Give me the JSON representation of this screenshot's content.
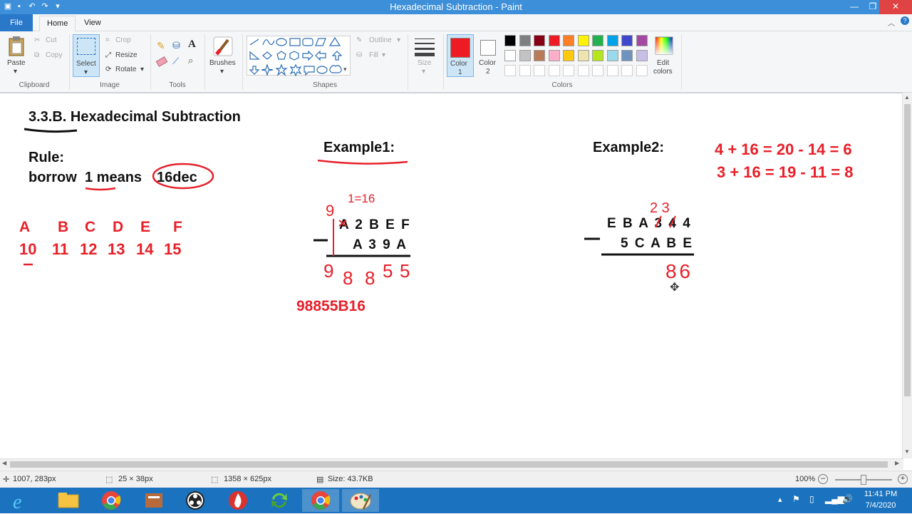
{
  "window": {
    "title": "Hexadecimal Subtraction - Paint"
  },
  "tabs": {
    "file": "File",
    "home": "Home",
    "view": "View"
  },
  "clipboard": {
    "paste": "Paste",
    "cut": "Cut",
    "copy": "Copy",
    "label": "Clipboard"
  },
  "image": {
    "select": "Select",
    "crop": "Crop",
    "resize": "Resize",
    "rotate": "Rotate",
    "label": "Image"
  },
  "tools": {
    "label": "Tools"
  },
  "brushes": {
    "label": "Brushes"
  },
  "shapes": {
    "outline": "Outline",
    "fill": "Fill",
    "label": "Shapes"
  },
  "size": {
    "label": "Size"
  },
  "colors": {
    "color1_label": "Color",
    "color1_num": "1",
    "color2_label": "Color",
    "color2_num": "2",
    "edit_label": "Edit",
    "edit_label2": "colors",
    "label": "Colors",
    "color1": "#ed1c24",
    "color2": "#ffffff",
    "palette_row1": [
      "#000000",
      "#7f7f7f",
      "#880015",
      "#ed1c24",
      "#ff7f27",
      "#fff200",
      "#22b14c",
      "#00a2e8",
      "#3f48cc",
      "#a349a4"
    ],
    "palette_row2": [
      "#ffffff",
      "#c3c3c3",
      "#b97a57",
      "#ffaec9",
      "#ffc90e",
      "#efe4b0",
      "#b5e61d",
      "#99d9ea",
      "#7092be",
      "#c8bfe7"
    ]
  },
  "canvas": {
    "section_title": "3.3.B. Hexadecimal Subtraction",
    "rule_label": "Rule:",
    "rule_text_1": "borrow",
    "rule_text_2": "1 means",
    "rule_text_3": "16dec",
    "hex_letters": [
      "A",
      "B",
      "C",
      "D",
      "E",
      "F"
    ],
    "hex_values": [
      "10",
      "11",
      "12",
      "13",
      "14",
      "15"
    ],
    "example1_title": "Example1:",
    "example1_top": "A 2 B E F",
    "example1_bottom": "A 3 9 A",
    "example1_borrow_a": "9",
    "example1_borrow_b": "1=16",
    "example1_digits": [
      "9",
      "8",
      "8",
      "5",
      "5"
    ],
    "example1_answer": "98855B16",
    "example2_title": "Example2:",
    "example2_top": "E B A 3 4 4",
    "example2_bottom": "5 C A B E",
    "example2_borrow": "2 3",
    "example2_digits": "8 6",
    "eq1": "4 + 16 = 20 - 14 = 6",
    "eq2": "3 + 16 = 19 - 11 = 8"
  },
  "status": {
    "cursor_pos": "1007, 283px",
    "selection_size": "25 × 38px",
    "image_size": "1358 × 625px",
    "file_size": "Size: 43.7KB",
    "zoom": "100%"
  },
  "taskbar": {
    "time": "11:41 PM",
    "date": "7/4/2020"
  }
}
